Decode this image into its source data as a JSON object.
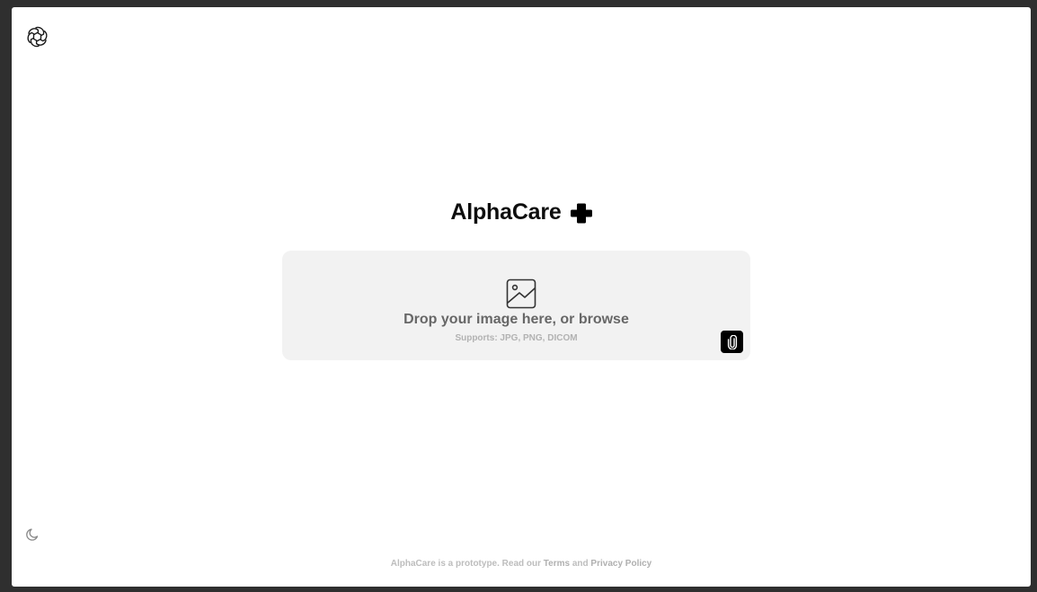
{
  "header": {
    "logo_icon": "openai-knot-icon"
  },
  "main": {
    "title": "AlphaCare",
    "title_icon": "medical-cross-icon",
    "dropzone": {
      "icon": "image-icon",
      "primary_text": "Drop your image here, or browse",
      "secondary_text": "Supports: JPG, PNG, DICOM",
      "attach_icon": "paperclip-icon"
    }
  },
  "sidebar": {
    "theme_icon": "moon-icon"
  },
  "footer": {
    "prefix": "AlphaCare is a prototype. Read our ",
    "terms_label": "Terms",
    "joiner": " and ",
    "privacy_label": "Privacy Policy"
  },
  "colors": {
    "background_outer": "#2f2f2f",
    "surface": "#ffffff",
    "dropzone_bg": "#f2f2f2",
    "accent": "#000000"
  }
}
